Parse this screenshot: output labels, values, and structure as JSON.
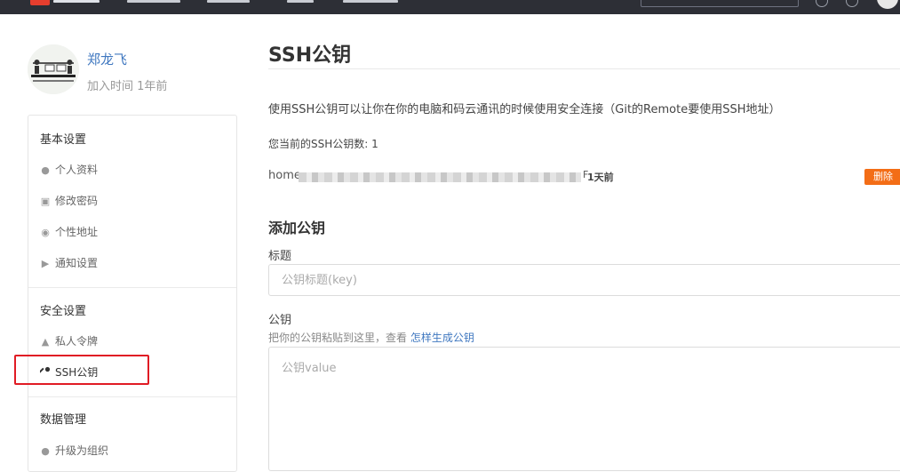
{
  "profile": {
    "name": "郑龙飞",
    "join_time": "加入时间 1年前"
  },
  "sidebar": {
    "groups": [
      {
        "title": "基本设置",
        "items": [
          {
            "label": "个人资料",
            "icon": "user-icon"
          },
          {
            "label": "修改密码",
            "icon": "lock-icon"
          },
          {
            "label": "个性地址",
            "icon": "compass-icon"
          },
          {
            "label": "通知设置",
            "icon": "speaker-icon"
          }
        ]
      },
      {
        "title": "安全设置",
        "items": [
          {
            "label": "私人令牌",
            "icon": "token-icon"
          },
          {
            "label": "SSH公钥",
            "icon": "key-icon",
            "active": true
          }
        ]
      },
      {
        "title": "数据管理",
        "items": [
          {
            "label": "升级为组织",
            "icon": "users-icon"
          }
        ]
      }
    ]
  },
  "main": {
    "title": "SSH公钥",
    "description": "使用SSH公钥可以让你在你的电脑和码云通讯的时候使用安全连接（Git的Remote要使用SSH地址）",
    "count_label": "您当前的SSH公钥数: 1",
    "key": {
      "prefix": "home",
      "suffix": "F",
      "time": "1天前",
      "delete_label": "删除"
    },
    "add_title": "添加公钥",
    "title_label": "标题",
    "title_placeholder": "公钥标题(key)",
    "key_label": "公钥",
    "help_text": "把你的公钥粘贴到这里，查看 ",
    "help_link": "怎样生成公钥",
    "key_placeholder": "公钥value"
  },
  "colors": {
    "link": "#4078c0",
    "danger_button": "#f36d16",
    "highlight": "#e01b24",
    "topbar": "#2d2f36"
  }
}
